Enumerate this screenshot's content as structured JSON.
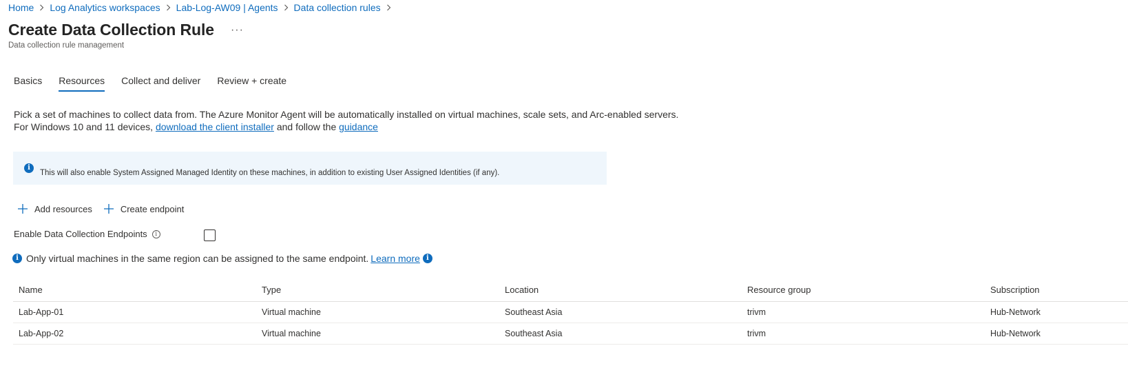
{
  "breadcrumb": [
    "Home",
    "Log Analytics workspaces",
    "Lab-Log-AW09 | Agents",
    "Data collection rules"
  ],
  "page": {
    "title": "Create Data Collection Rule",
    "more_label": "···",
    "subtitle": "Data collection rule management"
  },
  "tabs": [
    {
      "label": "Basics",
      "active": false
    },
    {
      "label": "Resources",
      "active": true
    },
    {
      "label": "Collect and deliver",
      "active": false
    },
    {
      "label": "Review + create",
      "active": false
    }
  ],
  "description": {
    "line1": "Pick a set of machines to collect data from. The Azure Monitor Agent will be automatically installed on virtual machines, scale sets, and Arc-enabled servers.",
    "line2_prefix": "For Windows 10 and 11 devices, ",
    "installer_link": "download the client installer",
    "line2_middle": " and follow the ",
    "guidance_link": "guidance"
  },
  "info_banner": {
    "text": "This will also enable System Assigned Managed Identity on these machines, in addition to existing User Assigned Identities (if any)."
  },
  "commands": {
    "add_resources": "Add resources",
    "create_endpoint": "Create endpoint"
  },
  "dce": {
    "label": "Enable Data Collection Endpoints",
    "checked": false
  },
  "region_note": {
    "text": "Only virtual machines in the same region can be assigned to the same endpoint.",
    "link": "Learn more"
  },
  "table": {
    "columns": [
      "Name",
      "Type",
      "Location",
      "Resource group",
      "Subscription"
    ],
    "rows": [
      [
        "Lab-App-01",
        "Virtual machine",
        "Southeast Asia",
        "trivm",
        "Hub-Network"
      ],
      [
        "Lab-App-02",
        "Virtual machine",
        "Southeast Asia",
        "trivm",
        "Hub-Network"
      ]
    ]
  },
  "colors": {
    "accent": "#0f6cbd",
    "banner_bg": "#eff6fc",
    "text": "#323130"
  }
}
